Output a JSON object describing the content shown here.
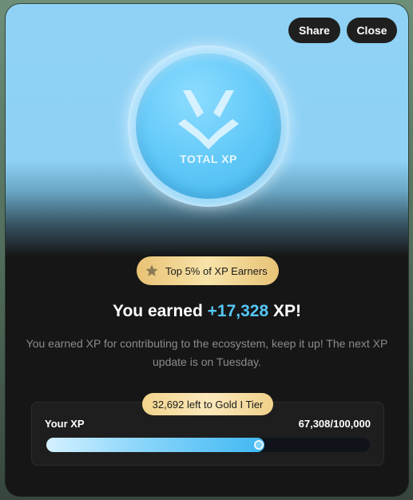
{
  "header": {
    "share_label": "Share",
    "close_label": "Close"
  },
  "coin": {
    "label": "TOTAL XP",
    "icon": "xp-logo-icon"
  },
  "badge": {
    "icon": "star-icon",
    "text": "Top 5% of XP Earners"
  },
  "headline": {
    "prefix": "You earned ",
    "amount": "+17,328",
    "suffix": " XP!"
  },
  "description": "You earned XP for contributing to the ecosystem, keep it up! The next XP update is on Tuesday.",
  "progress": {
    "tier_text": "32,692 left to Gold I Tier",
    "label": "Your XP",
    "value_text": "67,308/100,000",
    "current": 67308,
    "max": 100000
  },
  "colors": {
    "accent": "#55c6f5",
    "gold": "#f2d48c"
  }
}
